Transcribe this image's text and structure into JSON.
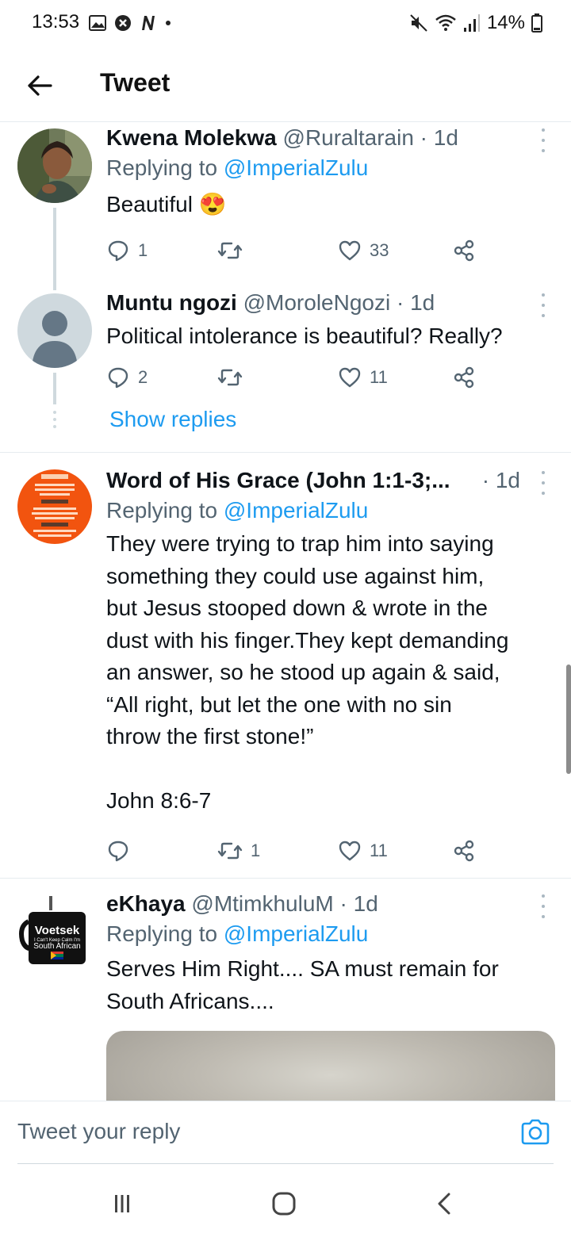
{
  "status_bar": {
    "time": "13:53",
    "battery": "14%"
  },
  "header": {
    "title": "Tweet"
  },
  "tweets": [
    {
      "name": "Kwena Molekwa",
      "handle": "@Ruraltarain",
      "time": "· 1d",
      "replying_prefix": "Replying to ",
      "replying_to": "@ImperialZulu",
      "text": "Beautiful",
      "emoji": "😍",
      "replies": "1",
      "retweets": "",
      "likes": "33"
    },
    {
      "name": "Muntu ngozi",
      "handle": "@MoroleNgozi",
      "time": "· 1d",
      "text": "Political intolerance is beautiful? Really?",
      "replies": "2",
      "retweets": "",
      "likes": "11"
    },
    {
      "name": "Word of His Grace (John 1:1-3;...",
      "time": "· 1d",
      "replying_prefix": "Replying to ",
      "replying_to": "@ImperialZulu",
      "text": "They were trying to trap him into saying\nsomething they could use against him,\nbut Jesus stooped down & wrote in the\ndust with his finger.They kept demanding\nan answer, so he stood up again & said,\n“All right, but let the one with no sin\nthrow the first stone!”\n\nJohn 8:6-7",
      "replies": "",
      "retweets": "1",
      "likes": "11"
    },
    {
      "name": "eKhaya",
      "handle": "@MtimkhuluM",
      "time": "· 1d",
      "replying_prefix": "Replying to ",
      "replying_to": "@ImperialZulu",
      "text": "Serves Him Right.... SA must remain for\nSouth Africans....",
      "avatar_text": [
        "Voetsek",
        "I Can't Keep Calm I'm",
        "South African"
      ]
    }
  ],
  "show_replies": "Show replies",
  "reply_bar": {
    "placeholder": "Tweet your reply"
  },
  "colors": {
    "accent": "#1d9bf0",
    "secondary_text": "#536471",
    "divider": "#e6ecf0"
  },
  "icons": {
    "back": "arrow-left-icon",
    "reply": "reply-bubble-icon",
    "retweet": "retweet-icon",
    "like": "heart-icon",
    "share": "share-icon",
    "more": "more-vertical-icon",
    "camera": "camera-icon"
  }
}
